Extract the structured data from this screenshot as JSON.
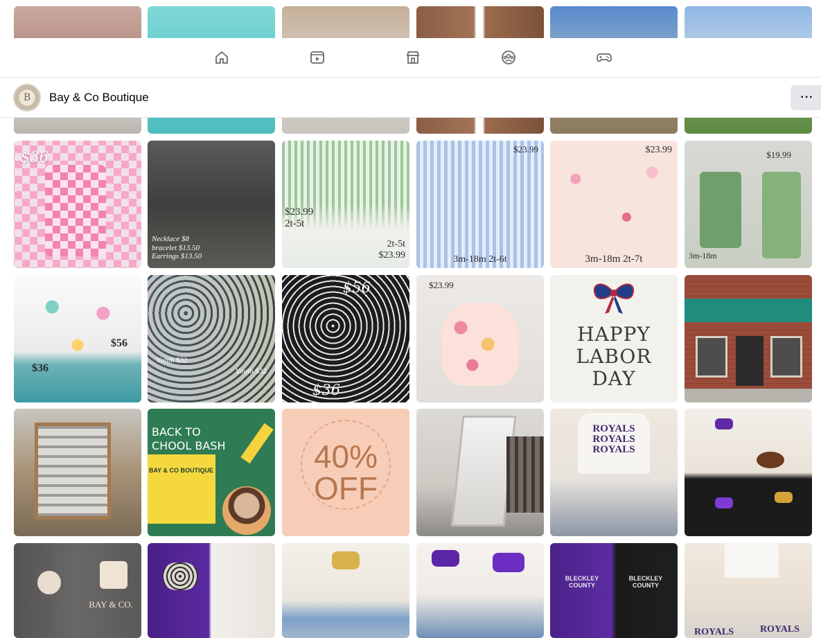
{
  "top_nav": {
    "icons": [
      "home-icon",
      "video-icon",
      "marketplace-icon",
      "groups-icon",
      "gaming-icon"
    ]
  },
  "page_header": {
    "avatar_letter": "B",
    "name": "Bay & Co Boutique",
    "more_label": "···"
  },
  "grid": {
    "row1": [
      {
        "name": "photo-woman-pink-top"
      },
      {
        "name": "photo-teal-sweatshirt"
      },
      {
        "name": "photo-woman-sunglasses"
      },
      {
        "name": "photo-brown-cardigan"
      },
      {
        "name": "photo-boy-outdoors"
      },
      {
        "name": "photo-child-outdoors"
      }
    ],
    "row2": [
      {
        "name": "photo-checkered-tumbler",
        "text": "$36"
      },
      {
        "name": "photo-jewelry",
        "text": "Necklace $8\nbracelet $13.50\nEarrings $13.50"
      },
      {
        "name": "photo-gingham-set",
        "text": "$23.99\n2t-5t",
        "text2": "2t-5t\n$23.99"
      },
      {
        "name": "photo-pumpkin-smocked",
        "text": "$23.99",
        "text2": "3m-18m    2t-6t"
      },
      {
        "name": "photo-floral-bows-outfits",
        "text": "$23.99",
        "text2": "3m-18m    2t-7t"
      },
      {
        "name": "photo-green-smocked",
        "text": "$19.99",
        "text2": "3m-18m"
      }
    ],
    "row3": [
      {
        "name": "photo-bow-bag-tumbler",
        "text": "$56",
        "text2": "$36"
      },
      {
        "name": "photo-leopard-caps",
        "text": "Youth $32",
        "text2": "Youth $32"
      },
      {
        "name": "photo-bow-tote-tumbler",
        "text": "$56",
        "text2": "$36"
      },
      {
        "name": "photo-floral-romper",
        "text": "$23.99"
      },
      {
        "name": "photo-labor-day",
        "text": "HAPPY\nLABOR\nDAY"
      },
      {
        "name": "photo-storefront"
      }
    ],
    "row4": [
      {
        "name": "photo-jewelry-display"
      },
      {
        "name": "photo-back-to-school",
        "text": "BACK TO\nCHOOL BASH",
        "text2": "BAY & CO BOUTIQUE"
      },
      {
        "name": "photo-40-off",
        "text": "40%\nOFF"
      },
      {
        "name": "photo-shop-interior"
      },
      {
        "name": "photo-royals-tees",
        "text": "ROYALS\nROYALS\nROYALS"
      },
      {
        "name": "photo-football-bows-tees"
      }
    ],
    "row5": [
      {
        "name": "photo-bay-co-tees",
        "text": "BAY & CO."
      },
      {
        "name": "photo-purple-leopard-tees"
      },
      {
        "name": "photo-gold-bow-tee"
      },
      {
        "name": "photo-purple-bow-tees"
      },
      {
        "name": "photo-bleckley-county-tees",
        "text": "BLECKLEY COUNTY"
      },
      {
        "name": "photo-royals-tees-2",
        "text": "ROYALS",
        "text2": "ROYALS"
      }
    ]
  },
  "colors": {
    "nav_bg": "#ffffff",
    "divider": "#e4e6eb",
    "more_btn_bg": "#e4e6eb",
    "icon": "#65676b"
  }
}
